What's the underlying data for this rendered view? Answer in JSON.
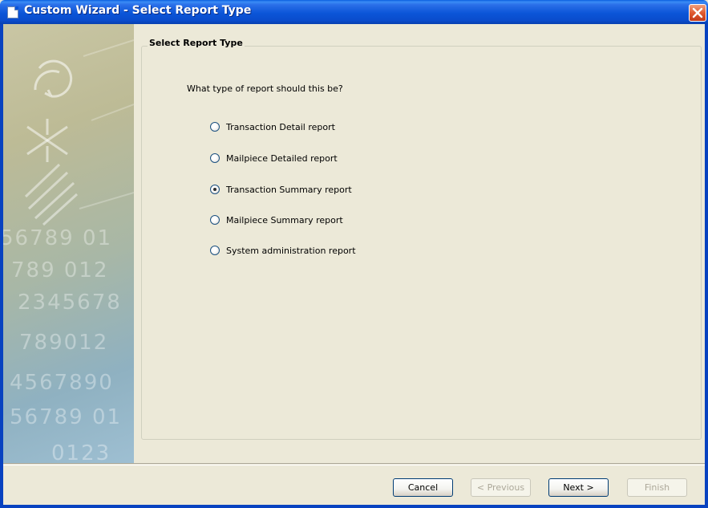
{
  "window": {
    "title": "Custom Wizard - Select Report Type"
  },
  "group": {
    "legend": "Select Report Type",
    "question": "What type of report should this be?"
  },
  "options": [
    {
      "label": "Transaction Detail report",
      "checked": false
    },
    {
      "label": "Mailpiece Detailed report",
      "checked": false
    },
    {
      "label": "Transaction Summary report",
      "checked": true
    },
    {
      "label": "Mailpiece Summary report",
      "checked": false
    },
    {
      "label": "System administration report",
      "checked": false
    }
  ],
  "buttons": {
    "cancel": "Cancel",
    "previous": "< Previous",
    "next": "Next >",
    "finish": "Finish"
  },
  "art": {
    "digit_rows": [
      "56789 01",
      "789 012",
      "2345678",
      "789012",
      "4567890",
      "56789 01",
      "0123"
    ]
  },
  "icons": {
    "title": "document-icon",
    "close": "close-icon"
  },
  "colors": {
    "titlebar": "#0b55d8",
    "close": "#e05a30",
    "dialog_bg": "#ece9d8"
  }
}
